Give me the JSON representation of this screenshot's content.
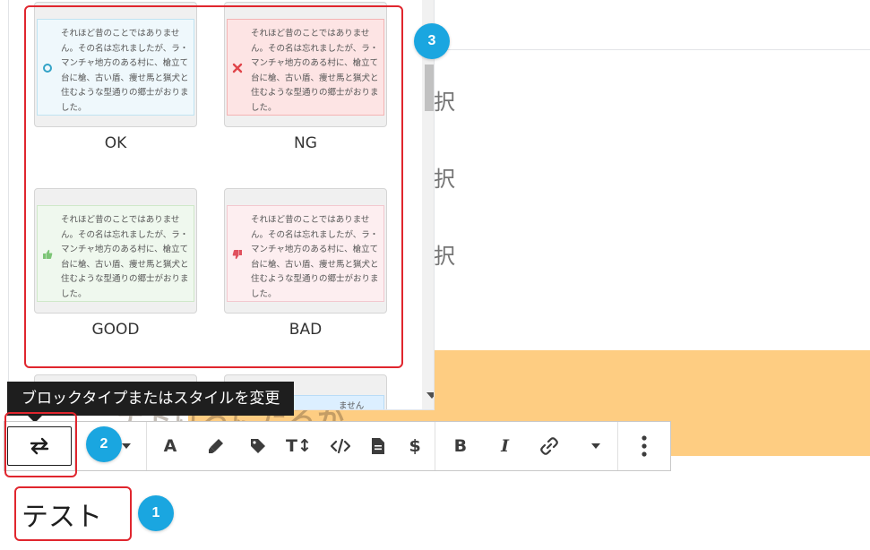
{
  "background": {
    "choice_text_1": "択",
    "choice_text_2": "択",
    "choice_text_3": "択",
    "orange_block_text": "ナトけるにたるか"
  },
  "style_popover": {
    "styles": [
      {
        "label": "OK",
        "icon": "circle-icon",
        "preview_text": "それほど昔のことではありません。その名は忘れましたが、ラ・マンチャ地方のある村に、槍立て台に槍、古い盾、痩せ馬と猟犬と住むような型通りの郷士がおりました。"
      },
      {
        "label": "NG",
        "icon": "x-icon",
        "preview_text": "それほど昔のことではありません。その名は忘れましたが、ラ・マンチャ地方のある村に、槍立て台に槍、古い盾、痩せ馬と猟犬と住むような型通りの郷士がおりました。"
      },
      {
        "label": "GOOD",
        "icon": "thumbs-up-icon",
        "preview_text": "それほど昔のことではありません。その名は忘れましたが、ラ・マンチャ地方のある村に、槍立て台に槍、古い盾、痩せ馬と猟犬と住むような型通りの郷士がおりました。"
      },
      {
        "label": "BAD",
        "icon": "thumbs-down-icon",
        "preview_text": "それほど昔のことではありません。その名は忘れましたが、ラ・マンチャ地方のある村に、槍立て台に槍、古い盾、痩せ馬と猟犬と住むような型通りの郷士がおりました。"
      }
    ],
    "partial_preview_text": "ません"
  },
  "tooltip": {
    "text": "ブロックタイプまたはスタイルを変更"
  },
  "toolbar": {
    "text_color_label": "A",
    "bold_label": "B",
    "italic_label": "I",
    "dollar_label": "$",
    "font_size_label": "T↕"
  },
  "block": {
    "text": "テスト"
  },
  "badges": {
    "one": "1",
    "two": "2",
    "three": "3"
  },
  "colors": {
    "highlight_red": "#e0262e",
    "badge_blue": "#1aa6e0",
    "orange_block": "#fecd82"
  }
}
